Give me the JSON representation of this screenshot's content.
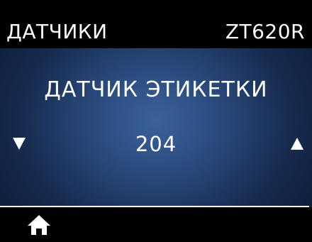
{
  "header": {
    "title": "ДАТЧИКИ",
    "model": "ZT620R"
  },
  "setting": {
    "name": "ДАТЧИК ЭТИКЕТКИ",
    "value": "204"
  },
  "controls": {
    "decrease_icon": "triangle-down-icon",
    "increase_icon": "triangle-up-icon",
    "home_icon": "home-icon"
  },
  "colors": {
    "text": "#ffffff",
    "bar_background": "#000000",
    "panel_center": "#3b629c",
    "panel_edge": "#0b1630"
  }
}
